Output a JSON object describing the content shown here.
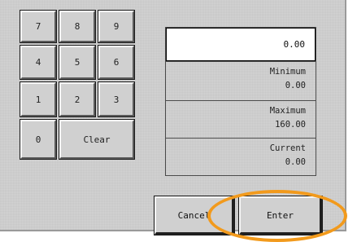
{
  "keypad": {
    "k7": "7",
    "k8": "8",
    "k9": "9",
    "k4": "4",
    "k5": "5",
    "k6": "6",
    "k1": "1",
    "k2": "2",
    "k3": "3",
    "k0": "0",
    "clear": "Clear"
  },
  "entry": {
    "value": "0.00"
  },
  "limits": {
    "minimum_label": "Minimum",
    "minimum_value": "0.00",
    "maximum_label": "Maximum",
    "maximum_value": "160.00",
    "current_label": "Current",
    "current_value": "0.00"
  },
  "actions": {
    "cancel": "Cancel",
    "enter": "Enter"
  },
  "colors": {
    "highlight": "#f29a1c",
    "background": "#d4d4d4"
  }
}
